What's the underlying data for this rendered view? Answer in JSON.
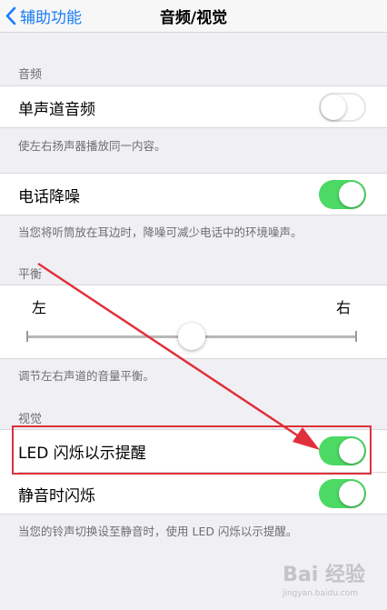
{
  "navbar": {
    "back_label": "辅助功能",
    "title": "音频/视觉"
  },
  "audio": {
    "header": "音频",
    "mono_label": "单声道音频",
    "mono_on": false,
    "mono_footer": "使左右扬声器播放同一内容。",
    "noise_label": "电话降噪",
    "noise_on": true,
    "noise_footer": "当您将听筒放在耳边时，降噪可减少电话中的环境噪声。"
  },
  "balance": {
    "header": "平衡",
    "left_label": "左",
    "right_label": "右",
    "value": 0.5,
    "footer": "调节左右声道的音量平衡。"
  },
  "visual": {
    "header": "视觉",
    "led_label": "LED 闪烁以示提醒",
    "led_on": true,
    "silent_label": "静音时闪烁",
    "silent_on": true,
    "footer": "当您的铃声切换设至静音时，使用 LED 闪烁以示提醒。"
  },
  "watermark": {
    "text": "Bai 经验",
    "sub": "jingyan.baidu.com"
  },
  "colors": {
    "accent": "#1a7cf5",
    "toggle_on": "#4cd964",
    "annotation": "#e0303a"
  },
  "icons": {
    "back": "chevron-left-icon"
  }
}
